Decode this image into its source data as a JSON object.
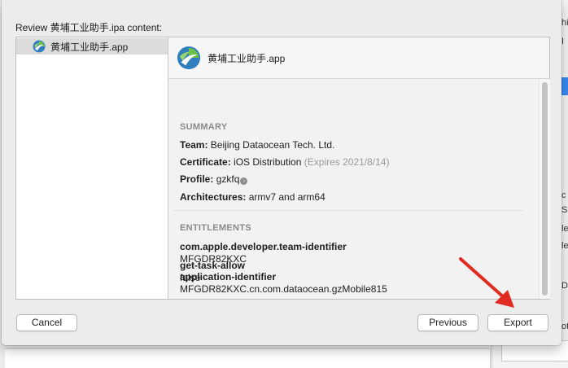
{
  "dialog": {
    "title": "Review 黄埔工业助手.ipa content:"
  },
  "source_list": {
    "items": [
      {
        "label": "黄埔工业助手.app",
        "icon": "app-icon"
      }
    ]
  },
  "detail": {
    "header_title": "黄埔工业助手.app",
    "summary": {
      "heading": "SUMMARY",
      "team_label": "Team:",
      "team_value": "Beijing Dataocean Tech. Ltd.",
      "certificate_label": "Certificate:",
      "certificate_value": "iOS Distribution",
      "certificate_expiry": "(Expires 2021/8/14)",
      "profile_label": "Profile:",
      "profile_value": "gzkfq",
      "architectures_label": "Architectures:",
      "architectures_value": "armv7 and arm64"
    },
    "entitlements": {
      "heading": "ENTITLEMENTS",
      "items": [
        {
          "key": "com.apple.developer.team-identifier",
          "value": "MFGDR82KXC"
        },
        {
          "key": "application-identifier",
          "value": "MFGDR82KXC.cn.com.dataocean.gzMobile815"
        },
        {
          "key": "get-task-allow",
          "value": "false"
        }
      ]
    }
  },
  "buttons": {
    "cancel": "Cancel",
    "previous": "Previous",
    "export": "Export"
  },
  "background": {
    "right_fragments": [
      "hi",
      "I",
      "c",
      "S",
      "le",
      "le",
      "D",
      "ot"
    ]
  },
  "colors": {
    "annotation_arrow": "#e02b20",
    "scrollbar_thumb": "#c2c2c2",
    "selection": "#dcdcdc"
  }
}
